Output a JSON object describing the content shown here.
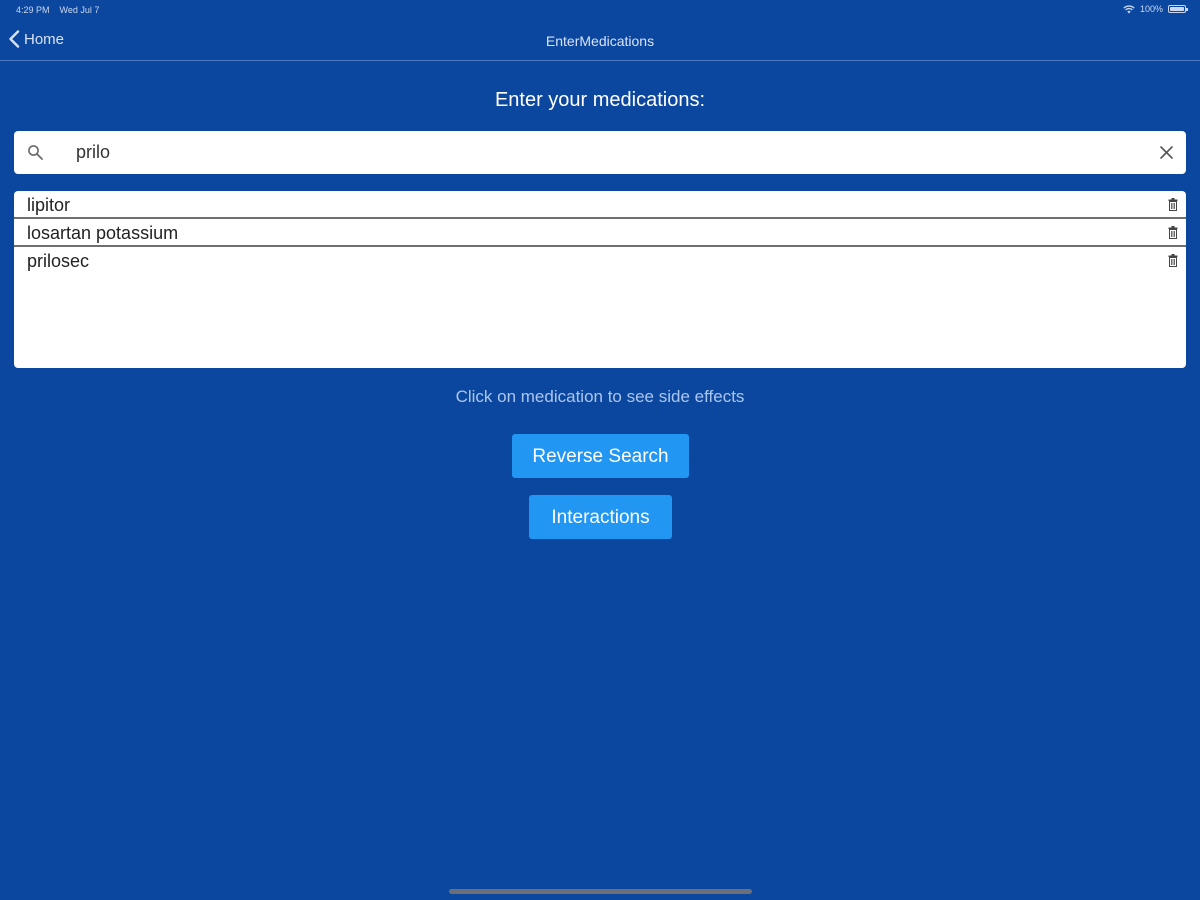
{
  "status_bar": {
    "time": "4:29 PM",
    "date": "Wed Jul 7",
    "battery_percent": "100%",
    "battery_level": 1.0
  },
  "nav": {
    "back_label": "Home",
    "title": "EnterMedications"
  },
  "heading": "Enter your medications:",
  "search": {
    "value": "prilo"
  },
  "medications": [
    {
      "name": "lipitor"
    },
    {
      "name": "losartan potassium"
    },
    {
      "name": "prilosec"
    }
  ],
  "hint": "Click on medication to see side effects",
  "buttons": {
    "reverse_search": "Reverse Search",
    "interactions": "Interactions"
  },
  "icons": {
    "back": "chevron-left-icon",
    "search": "search-icon",
    "clear": "close-icon",
    "delete": "trash-icon",
    "wifi": "wifi-icon",
    "battery": "battery-icon"
  },
  "colors": {
    "background": "#0c479f",
    "button": "#2196f3",
    "hint": "#aac6ee"
  }
}
